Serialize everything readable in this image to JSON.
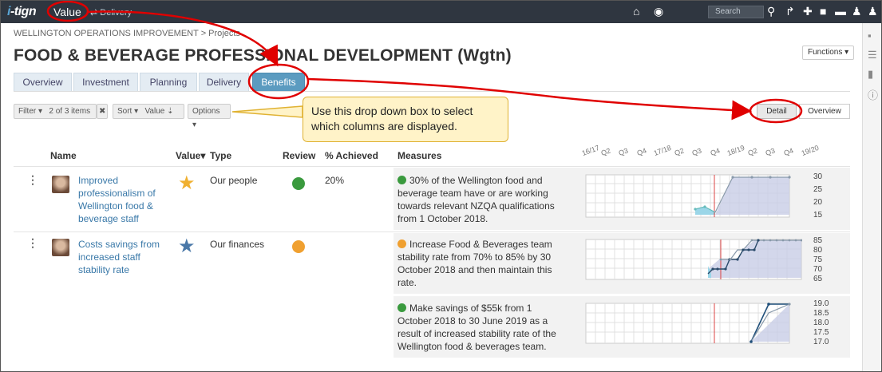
{
  "topbar": {
    "logo_i": "i",
    "logo_rest": "-tign",
    "nav_value": "Value",
    "nav_delivery": "Delivery",
    "search_placeholder": "Search"
  },
  "breadcrumb": "WELLINGTON OPERATIONS IMPROVEMENT > Projects",
  "page_title": "FOOD & BEVERAGE PROFESSIONAL DEVELOPMENT (Wgtn)",
  "functions_label": "Functions ▾",
  "tabs": [
    {
      "label": "Overview"
    },
    {
      "label": "Investment"
    },
    {
      "label": "Planning"
    },
    {
      "label": "Delivery"
    },
    {
      "label": "Benefits"
    }
  ],
  "filter": {
    "filter_label": "Filter ▾",
    "count": "2 of 3 items",
    "clear": "✖",
    "sort_label": "Sort ▾",
    "sort_by": "Value",
    "options_label": "Options ▾"
  },
  "view": {
    "detail": "Detail",
    "overview": "Overview"
  },
  "callout": "Use this drop down box to select which columns  are displayed.",
  "columns": {
    "name": "Name",
    "value": "Value",
    "type": "Type",
    "review": "Review",
    "achieved": "% Achieved",
    "measures": "Measures"
  },
  "timeline": [
    "16/17",
    "Q2",
    "Q3",
    "Q4",
    "17/18",
    "Q2",
    "Q3",
    "Q4",
    "18/19",
    "Q2",
    "Q3",
    "Q4",
    "19/20"
  ],
  "rows": [
    {
      "name": "Improved professionalism of Wellington food & beverage staff",
      "type": "Our people",
      "review_color": "#3a9a3e",
      "achieved": "20%",
      "star_color": "#f0b030",
      "measures": [
        {
          "text": "30% of the Wellington food and beverage team have or are working towards relevant NZQA qualifications from 1 October 2018.",
          "status_color": "#3a9a3e",
          "y_ticks": [
            "30",
            "25",
            "20",
            "15"
          ]
        }
      ]
    },
    {
      "name": "Costs savings from increased staff stability rate",
      "type": "Our finances",
      "review_color": "#f0a030",
      "achieved": "",
      "star_color": "#4a78a8",
      "measures": [
        {
          "text": "Increase Food & Beverages team stability rate from 70% to 85% by 30 October 2018 and then maintain this rate.",
          "status_color": "#f0a030",
          "y_ticks": [
            "85",
            "80",
            "75",
            "70",
            "65"
          ]
        },
        {
          "text": "Make savings of $55k from 1 October 2018 to 30 June 2019 as a result of increased stability rate of the Wellington food & beverages team.",
          "status_color": "#3a9a3e",
          "y_ticks": [
            "19.0",
            "18.5",
            "18.0",
            "17.5",
            "17.0"
          ]
        }
      ]
    }
  ],
  "colors": {
    "annotation_red": "#e00000",
    "active_tab": "#5b9bc0",
    "callout_bg": "#fff3c8",
    "link": "#3978a8"
  }
}
